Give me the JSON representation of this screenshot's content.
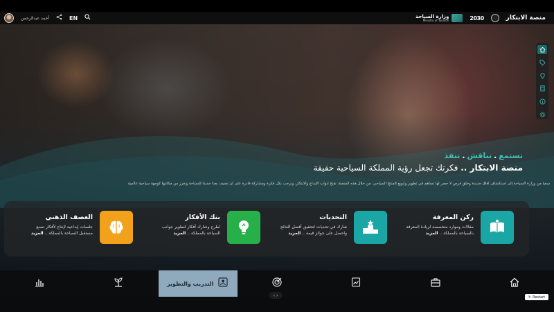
{
  "header": {
    "user_name": "أحمد عبدالرحمن",
    "lang_toggle": "EN",
    "platform_name": "منصة الابتكار",
    "vision_text": "2030",
    "ministry_ar": "وزارة السياحة",
    "ministry_en": "Ministry of Tourism"
  },
  "sidebar": {
    "items": [
      {
        "icon": "home-icon",
        "active": true
      },
      {
        "icon": "tag-icon"
      },
      {
        "icon": "pin-icon"
      },
      {
        "icon": "document-icon"
      },
      {
        "icon": "info-icon"
      },
      {
        "icon": "gear-icon"
      }
    ]
  },
  "hero": {
    "tag1": "نستمع",
    "tag2": "نناقش",
    "tag3": "ننفذ",
    "headline_bold": "منصة الابتكار ..",
    "headline_rest": "فكرتك تجعل رؤية المملكة السياحية حقيقة",
    "description": "سعياً من وزارة السياحة إلى استكشاف آفاق جديدة وخلق فرص لا حصر لها تساهم في تطوير وتنويع المنتج السياحي. من خلال هذه المنصة، نفتح أبواب الإبداع والابتكار، ونرحب بكل فكرة ومشاركة قادرة على أن تضيف بعداً جديداً للسياحة وتعزز من مكانتها كوجهة سياحية عالمية"
  },
  "cards": [
    {
      "title": "ركن المعرفة",
      "line1": "مقالات وموارد متخصصة لزيادة المعرفة",
      "line2": "بالسياحة بالمملكة ..",
      "more": "المزيد",
      "color": "#1ba6a6",
      "icon": "book-icon"
    },
    {
      "title": "التحديات",
      "line1": "شارك في تحديات لتحقيق أفضل النتائج",
      "line2": "واحصل على جوائز قيمة ..",
      "more": "المزيد",
      "color": "#1ba6a6",
      "icon": "podium-icon"
    },
    {
      "title": "بنك الأفكار",
      "line1": "اطرح وشارك أفكار لتطوير جوانب",
      "line2": "السياحة بالمملكة ..",
      "more": "المزيد",
      "color": "#27b04a",
      "icon": "lightbulb-icon"
    },
    {
      "title": "العصف الذهني",
      "line1": "جلسات إبداعية لإنتاج لأفكار تصنع",
      "line2": "مستقبل السياحة بالمملكة ..",
      "more": "المزيد",
      "color": "#f1a11a",
      "icon": "brain-icon"
    }
  ],
  "nav": {
    "active_label": "التدريب والتطوير",
    "items": [
      "home-icon",
      "briefcase-icon",
      "chart-doc-icon",
      "target-icon",
      "training-icon",
      "plant-icon",
      "bar-chart-icon"
    ]
  },
  "footer": {
    "restart_label": "Restart"
  }
}
